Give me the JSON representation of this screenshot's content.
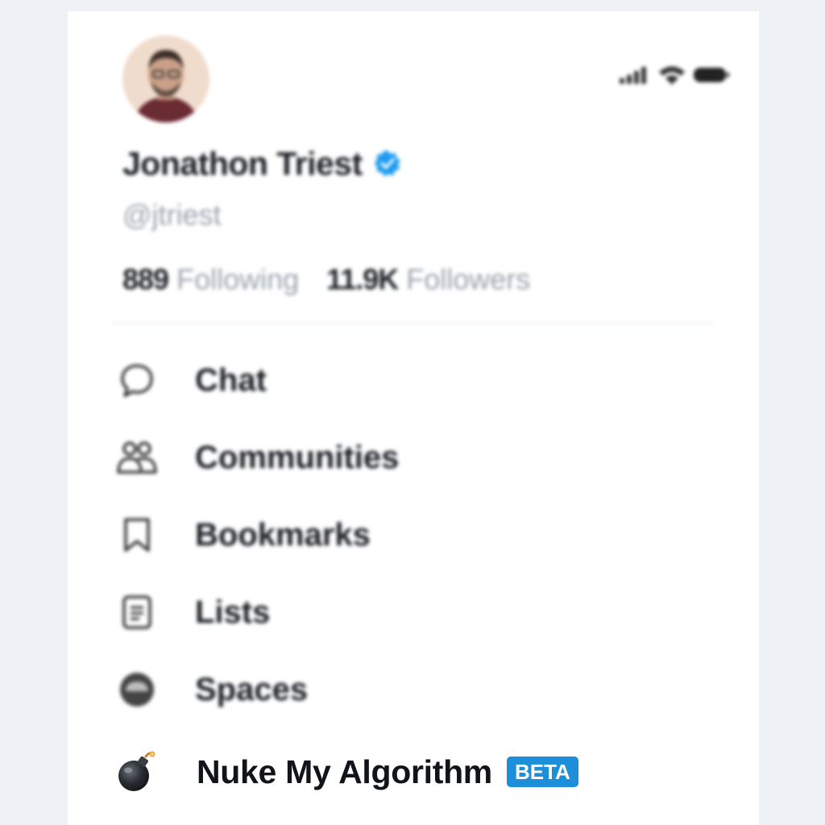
{
  "profile": {
    "name": "Jonathon Triest",
    "handle": "@jtriest",
    "verified": true,
    "following_count": "889",
    "following_label": "Following",
    "followers_count": "11.9K",
    "followers_label": "Followers"
  },
  "menu": {
    "items": [
      {
        "label": "Chat",
        "icon": "chat-bubble-icon"
      },
      {
        "label": "Communities",
        "icon": "communities-icon"
      },
      {
        "label": "Bookmarks",
        "icon": "bookmark-icon"
      },
      {
        "label": "Lists",
        "icon": "lists-icon"
      },
      {
        "label": "Spaces",
        "icon": "spaces-icon"
      }
    ],
    "featured": {
      "label": "Nuke My Algorithm",
      "badge": "BETA",
      "icon": "bomb-icon"
    }
  },
  "colors": {
    "verified_badge": "#1d9bf0",
    "beta_badge": "#1d8fd9",
    "text_primary": "#1b1f24",
    "text_secondary": "#9aa3ad",
    "background": "#eef1f5"
  }
}
